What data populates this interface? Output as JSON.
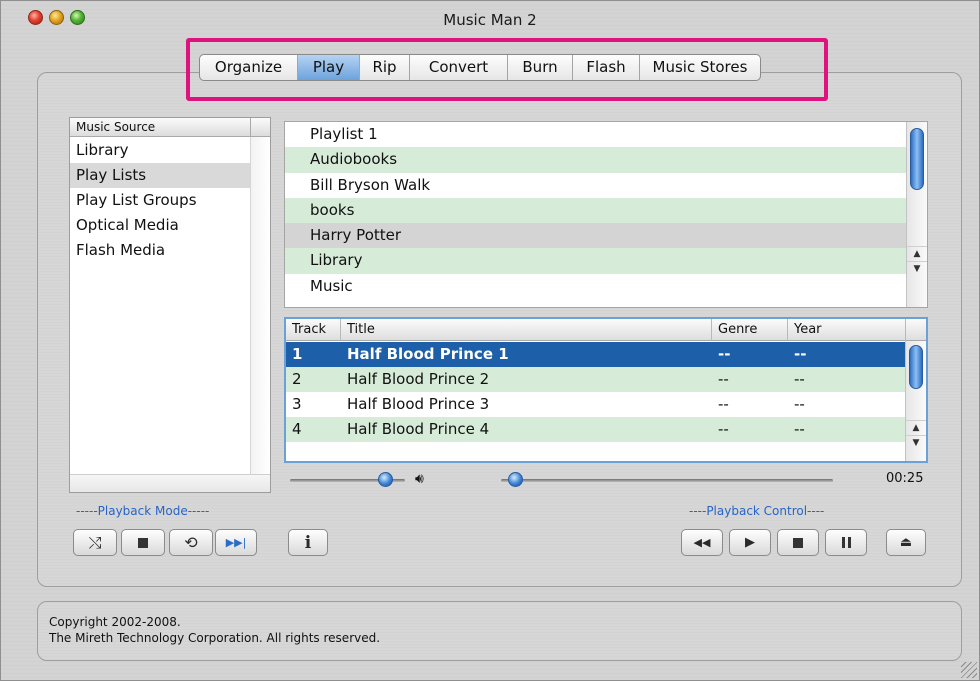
{
  "window": {
    "title": "Music Man 2"
  },
  "tabs": [
    {
      "label": "Organize",
      "active": false
    },
    {
      "label": "Play",
      "active": true
    },
    {
      "label": "Rip",
      "active": false
    },
    {
      "label": "Convert",
      "active": false
    },
    {
      "label": "Burn",
      "active": false
    },
    {
      "label": "Flash",
      "active": false
    },
    {
      "label": "Music Stores",
      "active": false
    }
  ],
  "source": {
    "header": "Music Source",
    "items": [
      "Library",
      "Play Lists",
      "Play List Groups",
      "Optical Media",
      "Flash Media"
    ],
    "selected": "Play Lists"
  },
  "playlists": {
    "items": [
      "Playlist 1",
      "Audiobooks",
      "Bill Bryson Walk",
      "books",
      "Harry Potter",
      "Library",
      "Music"
    ],
    "selected": "Harry Potter"
  },
  "tracks": {
    "columns": {
      "track": "Track",
      "title": "Title",
      "genre": "Genre",
      "year": "Year"
    },
    "rows": [
      {
        "track": "1",
        "title": "Half Blood Prince 1",
        "genre": "--",
        "year": "--"
      },
      {
        "track": "2",
        "title": "Half Blood Prince 2",
        "genre": "--",
        "year": "--"
      },
      {
        "track": "3",
        "title": "Half Blood Prince 3",
        "genre": "--",
        "year": "--"
      },
      {
        "track": "4",
        "title": "Half Blood Prince 4",
        "genre": "--",
        "year": "--"
      }
    ],
    "selected_track": "1"
  },
  "playback": {
    "volume_level": 0.75,
    "position_level": 0.02,
    "time": "00:25",
    "mode_label": "-----Playback Mode-----",
    "control_label": "----Playback Control----",
    "mode_icons": [
      "shuffle-icon",
      "stop-icon",
      "repeat-icon",
      "skip-next-icon"
    ],
    "control_icons": [
      "rewind-icon",
      "play-icon",
      "stop-icon",
      "pause-icon"
    ],
    "extra_icons": [
      "info-icon",
      "eject-icon"
    ]
  },
  "footer": {
    "line1": "Copyright 2002-2008.",
    "line2": "The Mireth Technology Corporation. All rights reserved."
  },
  "colors": {
    "highlight": "#e0127f",
    "selection": "#1d5fa8",
    "alt_row": "#d7ecd8",
    "accent_label": "#2864c6"
  }
}
